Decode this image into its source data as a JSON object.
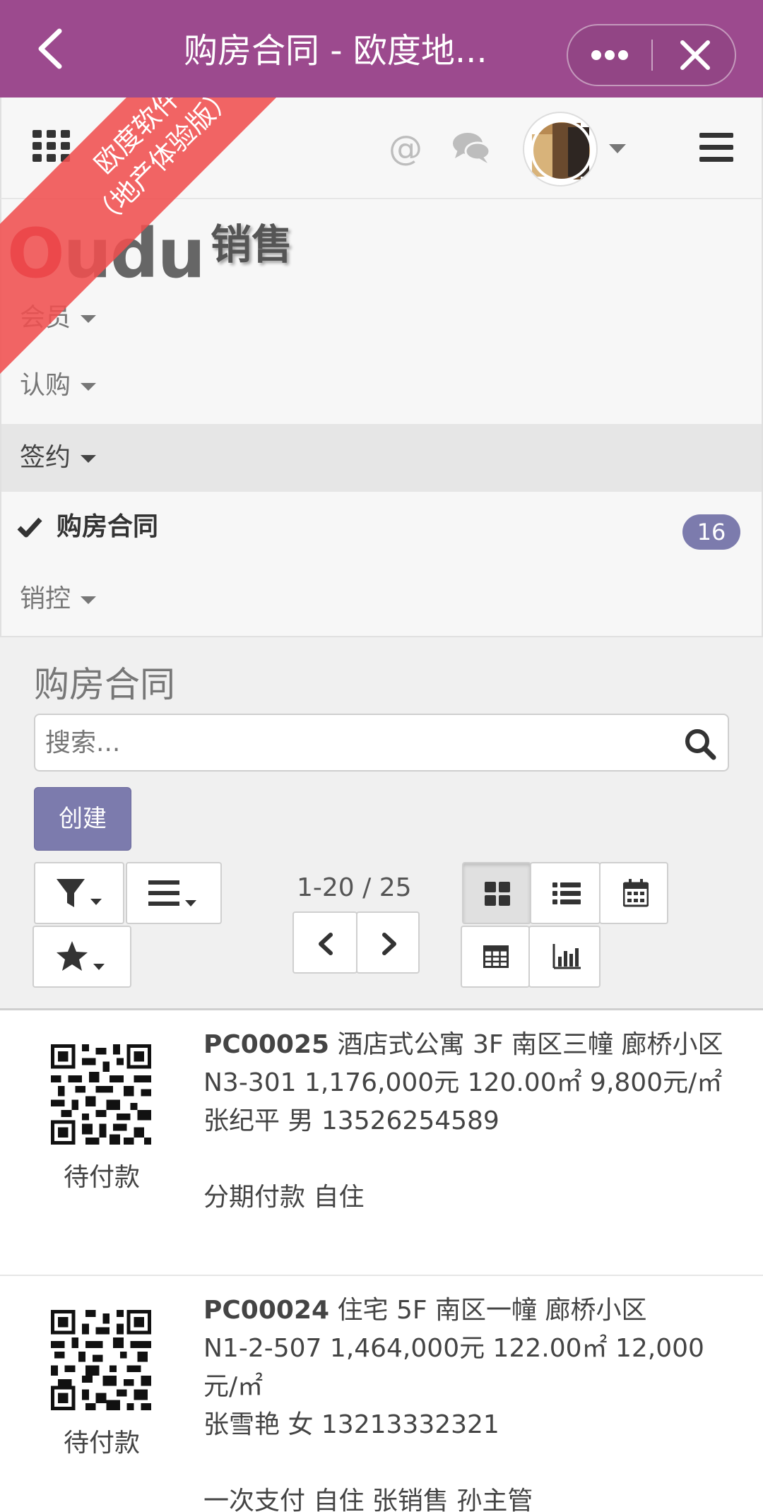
{
  "appbar": {
    "title": "购房合同 - 欧度地...",
    "back_icon": "chevron-left-icon",
    "more_icon": "ellipsis-icon",
    "close_icon": "close-icon",
    "color": "#9c4a8e"
  },
  "topbar": {
    "apps_icon": "apps-grid-icon",
    "at_icon_glyph": "@",
    "chat_icon": "chat-bubbles-icon",
    "menu_icon": "hamburger-icon"
  },
  "ribbon": {
    "line1": "欧度软件",
    "line2": "（地产体验版）",
    "color": "#f05050"
  },
  "brand": {
    "logo_o": "O",
    "logo_rest": "udu",
    "app_name": "销售"
  },
  "menu": {
    "items": [
      {
        "label": "会员"
      },
      {
        "label": "认购"
      },
      {
        "label": "签约"
      },
      {
        "label": "购房合同",
        "count": "16"
      },
      {
        "label": "销控"
      }
    ]
  },
  "panel": {
    "page_title": "购房合同",
    "search_placeholder": "搜索...",
    "create_label": "创建",
    "pager": "1-20 / 25",
    "accent": "#7c7bad"
  },
  "records": [
    {
      "code": "PC00025",
      "line1": "酒店式公寓 3F 南区三幢 廊桥小区",
      "line2": "N3-301 1,176,000元 120.00㎡ 9,800元/㎡",
      "line3": "张纪平 男 13526254589",
      "line4": "",
      "line5": "分期付款 自住",
      "status": "待付款"
    },
    {
      "code": "PC00024",
      "line1": "住宅 5F 南区一幢 廊桥小区",
      "line2": "N1-2-507 1,464,000元 122.00㎡ 12,000元/㎡",
      "line3": "张雪艳 女 13213332321",
      "line4": "",
      "line5": "一次支付 自住 张销售 孙主管",
      "status": "待付款"
    }
  ]
}
